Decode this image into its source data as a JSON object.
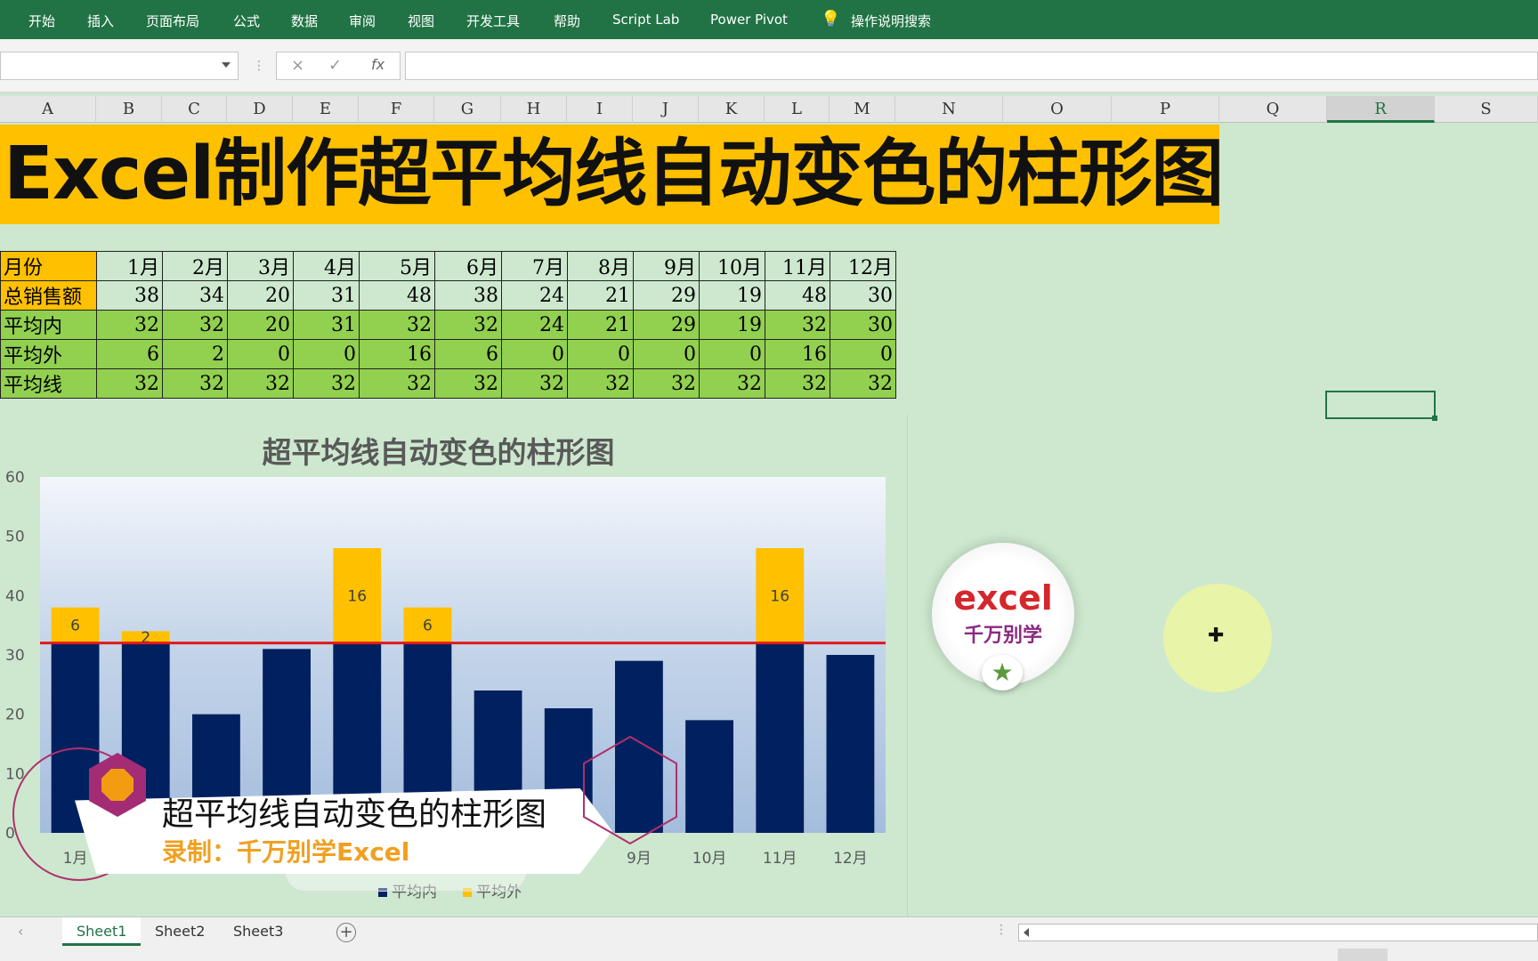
{
  "ribbon": {
    "tabs": [
      "开始",
      "插入",
      "页面布局",
      "公式",
      "数据",
      "审阅",
      "视图",
      "开发工具",
      "帮助",
      "Script Lab",
      "Power Pivot"
    ],
    "search": "操作说明搜索"
  },
  "formula_bar": {
    "cancel": "×",
    "enter": "✓",
    "fx": "fx"
  },
  "columns": [
    "A",
    "B",
    "C",
    "D",
    "E",
    "F",
    "G",
    "H",
    "I",
    "J",
    "K",
    "L",
    "M",
    "N",
    "O",
    "P",
    "Q",
    "R",
    "S"
  ],
  "selected_column": "R",
  "banner": "Excel制作超平均线自动变色的柱形图",
  "table": {
    "rows": [
      {
        "label": "月份",
        "values": [
          "1月",
          "2月",
          "3月",
          "4月",
          "5月",
          "6月",
          "7月",
          "8月",
          "9月",
          "10月",
          "11月",
          "12月"
        ]
      },
      {
        "label": "总销售额",
        "values": [
          "38",
          "34",
          "20",
          "31",
          "48",
          "38",
          "24",
          "21",
          "29",
          "19",
          "48",
          "30"
        ]
      },
      {
        "label": "平均内",
        "values": [
          "32",
          "32",
          "20",
          "31",
          "32",
          "32",
          "24",
          "21",
          "29",
          "19",
          "32",
          "30"
        ]
      },
      {
        "label": "平均外",
        "values": [
          "6",
          "2",
          "0",
          "0",
          "16",
          "6",
          "0",
          "0",
          "0",
          "0",
          "16",
          "0"
        ]
      },
      {
        "label": "平均线",
        "values": [
          "32",
          "32",
          "32",
          "32",
          "32",
          "32",
          "32",
          "32",
          "32",
          "32",
          "32",
          "32"
        ]
      }
    ]
  },
  "chart_data": {
    "type": "bar",
    "stacked": true,
    "title": "超平均线自动变色的柱形图",
    "categories": [
      "1月",
      "2月",
      "3月",
      "4月",
      "5月",
      "6月",
      "7月",
      "8月",
      "9月",
      "10月",
      "11月",
      "12月"
    ],
    "series": [
      {
        "name": "平均内",
        "values": [
          32,
          32,
          20,
          31,
          32,
          32,
          24,
          21,
          29,
          19,
          32,
          30
        ],
        "color": "#002060"
      },
      {
        "name": "平均外",
        "values": [
          6,
          2,
          0,
          0,
          16,
          6,
          0,
          0,
          0,
          0,
          16,
          0
        ],
        "color": "#ffc000"
      }
    ],
    "average_line": {
      "value": 32,
      "color": "#e0191b"
    },
    "yticks": [
      "0",
      "10",
      "20",
      "30",
      "40",
      "50",
      "60"
    ],
    "ylim": [
      0,
      60
    ],
    "grid": false,
    "legend": "bottom"
  },
  "overlay": {
    "title": "超平均线自动变色的柱形图",
    "subtitle": "录制：千万别学Excel"
  },
  "stamp": {
    "brand": "excel",
    "tagline": "千万别学"
  },
  "sheets": [
    "Sheet1",
    "Sheet2",
    "Sheet3"
  ],
  "active_sheet": "Sheet1"
}
